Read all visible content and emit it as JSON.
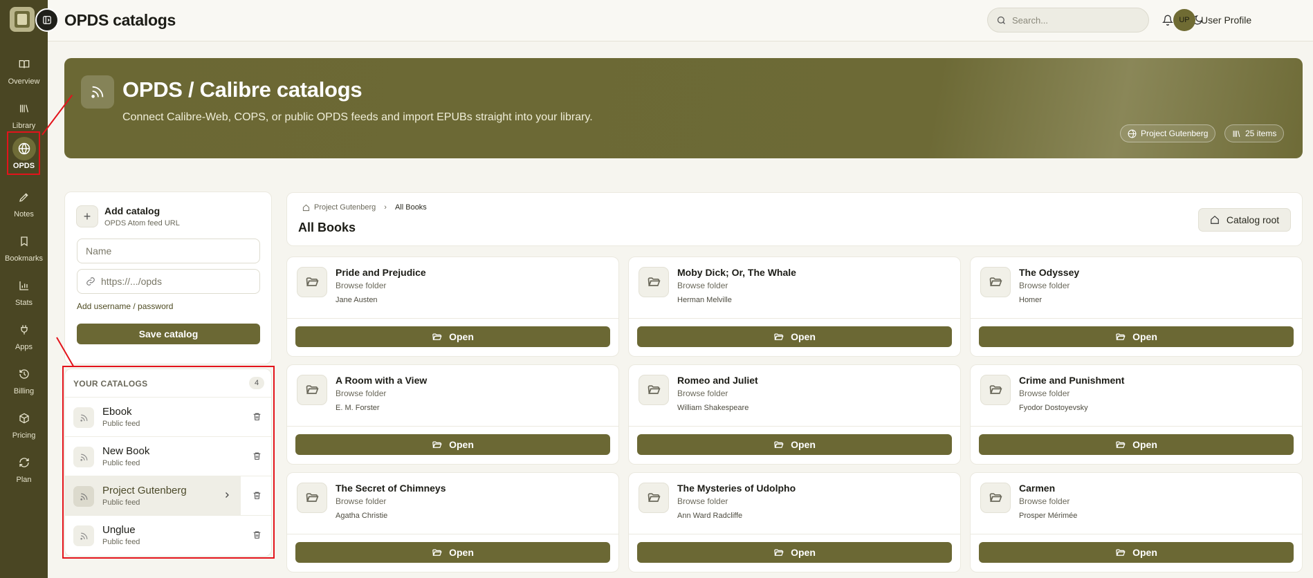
{
  "app": {
    "title": "OPDS catalogs"
  },
  "sidebar": {
    "items": [
      {
        "label": "Overview",
        "icon": "book-open-icon"
      },
      {
        "label": "Library",
        "icon": "library-icon"
      },
      {
        "label": "OPDS",
        "icon": "globe-icon",
        "active": true
      },
      {
        "label": "Notes",
        "icon": "pen-icon"
      },
      {
        "label": "Bookmarks",
        "icon": "bookmark-icon"
      },
      {
        "label": "Stats",
        "icon": "bar-chart-icon"
      },
      {
        "label": "Apps",
        "icon": "plug-icon"
      },
      {
        "label": "Billing",
        "icon": "history-icon"
      },
      {
        "label": "Pricing",
        "icon": "package-icon"
      },
      {
        "label": "Plan",
        "icon": "refresh-icon"
      }
    ]
  },
  "topbar": {
    "search_placeholder": "Search...",
    "avatar_initials": "UP",
    "profile_name": "User Profile"
  },
  "hero": {
    "title": "OPDS / Calibre catalogs",
    "description": "Connect Calibre-Web, COPS, or public OPDS feeds and import EPUBs straight into your library.",
    "catalog_pill": "Project Gutenberg",
    "items_pill": "25 items"
  },
  "add_catalog": {
    "title": "Add catalog",
    "subtitle": "OPDS Atom feed URL",
    "name_placeholder": "Name",
    "url_placeholder": "https://.../opds",
    "credentials_link": "Add username / password",
    "save_label": "Save catalog"
  },
  "catalogs": {
    "heading": "YOUR CATALOGS",
    "count": "4",
    "items": [
      {
        "name": "Ebook",
        "subtitle": "Public feed"
      },
      {
        "name": "New Book",
        "subtitle": "Public feed"
      },
      {
        "name": "Project Gutenberg",
        "subtitle": "Public feed",
        "selected": true
      },
      {
        "name": "Unglue",
        "subtitle": "Public feed"
      }
    ]
  },
  "browser": {
    "breadcrumb_root": "Project Gutenberg",
    "breadcrumb_current": "All Books",
    "title": "All Books",
    "root_button": "Catalog root"
  },
  "books": {
    "folder_label": "Browse folder",
    "open_label": "Open",
    "items": [
      {
        "title": "Pride and Prejudice",
        "author": "Jane Austen"
      },
      {
        "title": "Moby Dick; Or, The Whale",
        "author": "Herman Melville"
      },
      {
        "title": "The Odyssey",
        "author": "Homer"
      },
      {
        "title": "A Room with a View",
        "author": "E. M. Forster"
      },
      {
        "title": "Romeo and Juliet",
        "author": "William Shakespeare"
      },
      {
        "title": "Crime and Punishment",
        "author": "Fyodor Dostoyevsky"
      },
      {
        "title": "The Secret of Chimneys",
        "author": "Agatha Christie"
      },
      {
        "title": "The Mysteries of Udolpho",
        "author": "Ann Ward Radcliffe"
      },
      {
        "title": "Carmen",
        "author": "Prosper Mérimée"
      }
    ]
  },
  "colors": {
    "accent": "#6b6834",
    "sidebar": "#4a4623",
    "annotation": "#e3131b"
  }
}
